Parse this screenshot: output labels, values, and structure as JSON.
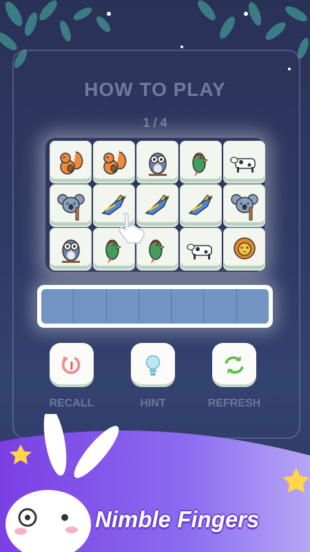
{
  "tutorial": {
    "title": "HOW TO PLAY",
    "page_indicator": "1 / 4"
  },
  "board": {
    "rows": [
      [
        "squirrel",
        "squirrel",
        "owl",
        "parrot",
        "cow"
      ],
      [
        "koala",
        "blue-bird",
        "blue-bird",
        "blue-bird",
        "koala"
      ],
      [
        "owl",
        "parrot",
        "parrot",
        "cow",
        "lion"
      ]
    ]
  },
  "slot_bar": {
    "slots": 7
  },
  "tools": {
    "recall_label": "RECALL",
    "hint_label": "HINT",
    "refresh_label": "REFRESH"
  },
  "promo": {
    "headline": "Nimble Fingers"
  },
  "colors": {
    "background": "#2f3a63",
    "tile_face": "#f3f6ee",
    "slot_bar": "#7194c2",
    "promo_purple": "#7a4be0"
  }
}
